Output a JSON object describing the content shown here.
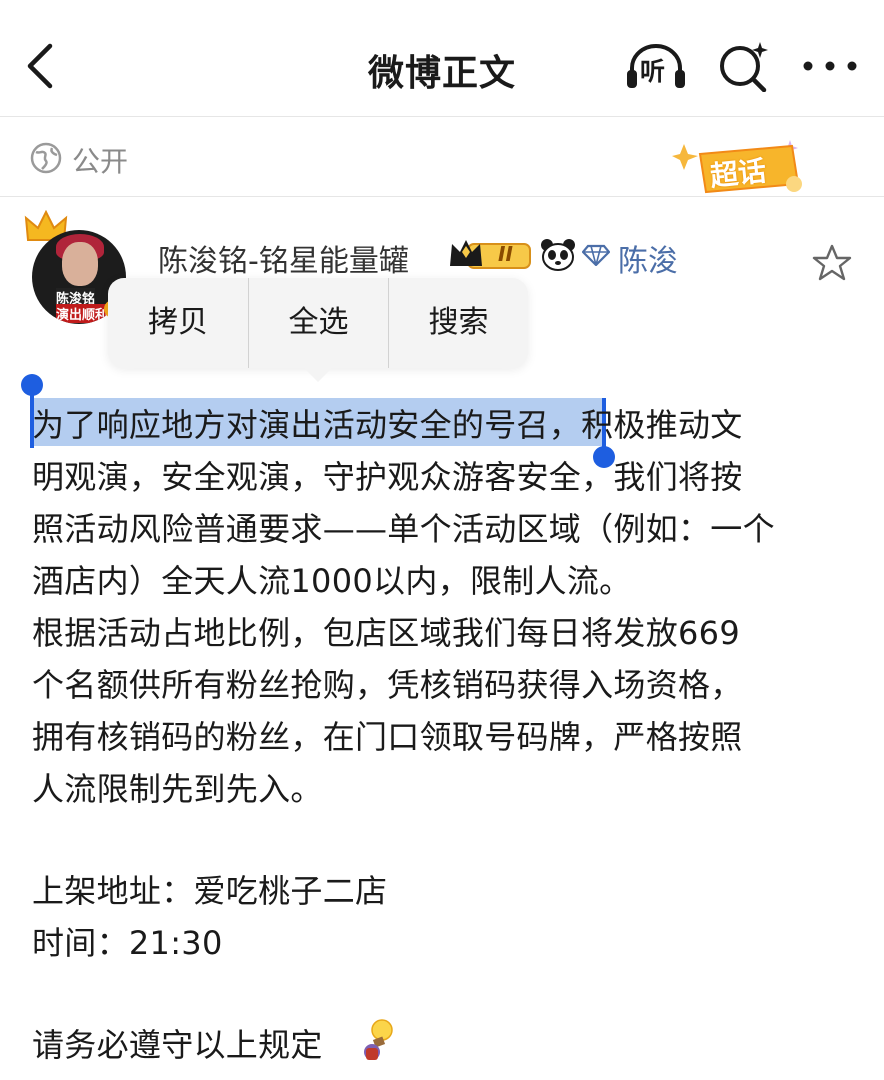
{
  "nav": {
    "title": "微博正文",
    "listen_label": "听",
    "icons": [
      "back-icon",
      "listen-icon",
      "search-icon",
      "more-icon"
    ]
  },
  "visibility": {
    "label": "公开",
    "icon": "globe-icon"
  },
  "supertopic": {
    "label": "超话"
  },
  "post": {
    "author": "陈浚铭-铭星能量罐",
    "level_badge": "II",
    "fan_label": "陈浚",
    "avatar_text_line1": "陈浚铭",
    "avatar_text_line2": "演出顺利"
  },
  "context_menu": {
    "items": [
      "拷贝",
      "全选",
      "搜索"
    ]
  },
  "content": {
    "lines": [
      "为了响应地方对演出活动安全的号召，积极推动文",
      "明观演，安全观演，守护观众游客安全，我们将按",
      "照活动风险普通要求——单个活动区域（例如：一个",
      "酒店内）全天人流1000以内，限制人流。",
      "根据活动占地比例，包店区域我们每日将发放669",
      "个名额供所有粉丝抢购，凭核销码获得入场资格，",
      "拥有核销码的粉丝，在门口领取号码牌，严格按照",
      "人流限制先到先入。",
      "上架地址：爱吃桃子二店",
      "时间：21:30",
      "请务必遵守以上规定"
    ],
    "selected_text": "为了响应地方对演出活动安全的号召"
  },
  "colors": {
    "selection_bg": "#b4cdf0",
    "caret": "#1e5ee0",
    "link_blue": "#4b6ea8",
    "muted": "#8a8a8a"
  }
}
